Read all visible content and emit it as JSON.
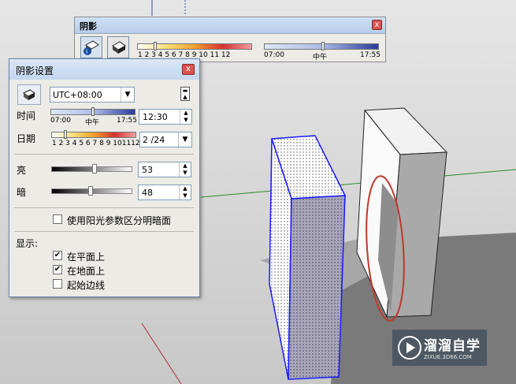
{
  "toolbar": {
    "title": "阴影",
    "close_label": "x",
    "month_ticks": "1 2 3 4 5 6 7 8 9 10 11 12",
    "time_start": "07:00",
    "time_mid": "中午",
    "time_end": "17:55"
  },
  "dialog": {
    "title": "阴影设置",
    "close_label": "x",
    "timezone": "UTC+08:00",
    "time_label": "时间",
    "time_start": "07:00",
    "time_mid": "中午",
    "time_end": "17:55",
    "time_value": "12:30",
    "date_label": "日期",
    "month_ticks": "1 2 3 4 5 6 7 8 9 101112",
    "date_value": "2 /24",
    "light_label": "亮",
    "light_value": "53",
    "dark_label": "暗",
    "dark_value": "48",
    "use_sun_label": "使用阳光参数区分明暗面",
    "display_label": "显示:",
    "on_faces_label": "在平面上",
    "on_ground_label": "在地面上",
    "from_edges_label": "起始边线",
    "on_faces_checked": true,
    "on_ground_checked": true,
    "from_edges_checked": false,
    "use_sun_checked": false,
    "light_level": 0.53,
    "dark_level": 0.48
  },
  "watermark": {
    "name": "溜溜自学",
    "url": "ZIXUE.3D66.COM"
  },
  "colors": {
    "highlight_oval": "#c0392b",
    "selection_blue": "#1a1aff"
  }
}
